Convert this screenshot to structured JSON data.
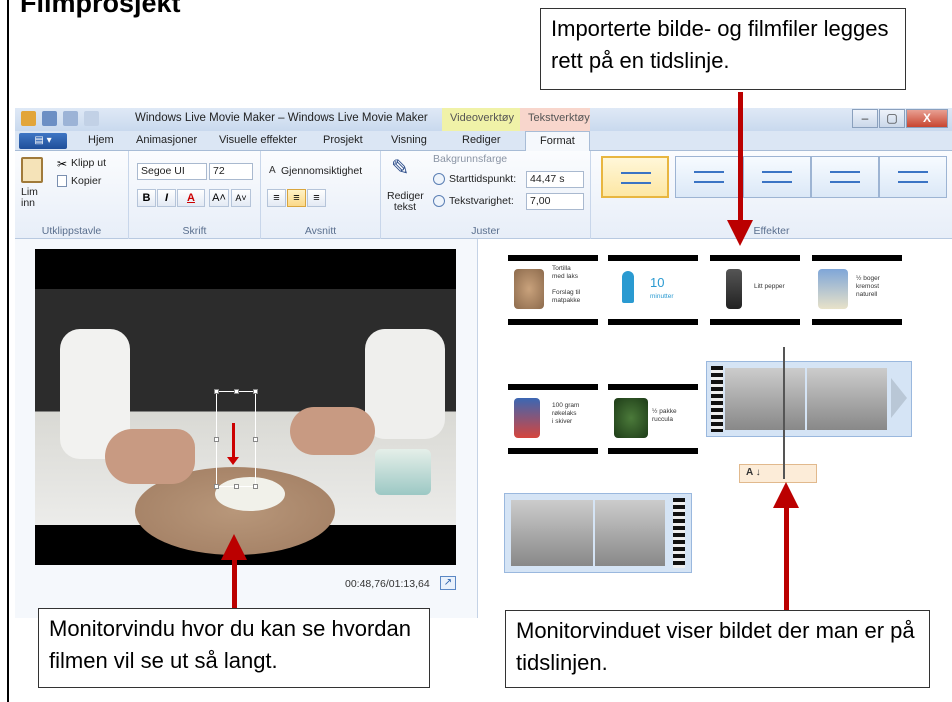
{
  "page": {
    "heading": "Filmprosjekt"
  },
  "callouts": {
    "top": "Importerte bilde- og filmfiler legges rett på en tidslinje.",
    "left": "Monitorvindu hvor du kan se hvordan filmen vil se ut så langt.",
    "right": "Monitorvinduet viser bildet der man er på tidslinjen."
  },
  "window": {
    "title": "Windows Live Movie Maker – Windows Live Movie Maker",
    "context_tab_video": "Videoverktøy",
    "context_tab_text": "Tekstverktøy",
    "minimize": "–",
    "maximize": "▢",
    "close": "X"
  },
  "tabs": {
    "app_menu": "▤ ▾",
    "items": [
      "Hjem",
      "Animasjoner",
      "Visuelle effekter",
      "Prosjekt",
      "Visning",
      "Rediger",
      "Format"
    ],
    "active": "Format"
  },
  "ribbon": {
    "clipboard": {
      "paste": "Lim inn",
      "cut": "Klipp ut",
      "copy": "Kopier",
      "label": "Utklippstavle"
    },
    "font": {
      "family": "Segoe UI",
      "size": "72",
      "bold": "B",
      "italic": "I",
      "color": "A",
      "grow": "A˄",
      "shrink": "A˅",
      "label": "Skrift"
    },
    "paragraph": {
      "transparency": "Gjennomsiktighet",
      "label": "Avsnitt"
    },
    "adjust": {
      "edit_text": "Rediger tekst",
      "background_color": "Bakgrunnsfarge",
      "start_time_label": "Starttidspunkt:",
      "start_time_value": "44,47 s",
      "duration_label": "Tekstvarighet:",
      "duration_value": "7,00",
      "label": "Juster"
    },
    "effects": {
      "label": "Effekter"
    }
  },
  "preview": {
    "time": "00:48,76/01:13,64",
    "fullscreen_icon": "↗"
  },
  "storyboard": {
    "clips": [
      {
        "text": "Tortilla\nmed laks\n\nForslag til\nmatpakke"
      },
      {
        "number": "10",
        "sub": "minutter"
      },
      {
        "text": "Litt pepper"
      },
      {
        "text": "½ boger\nkremost\nnaturell"
      },
      {
        "text": "100 gram\nrøkelaks\ni skiver"
      },
      {
        "text": "½ pakke\nruccula"
      }
    ],
    "caption_marker": "A ↓"
  },
  "colors": {
    "arrow": "#b00000",
    "ribbon_blue": "#1f4f9a",
    "accent_info": "#2a9ad1"
  }
}
